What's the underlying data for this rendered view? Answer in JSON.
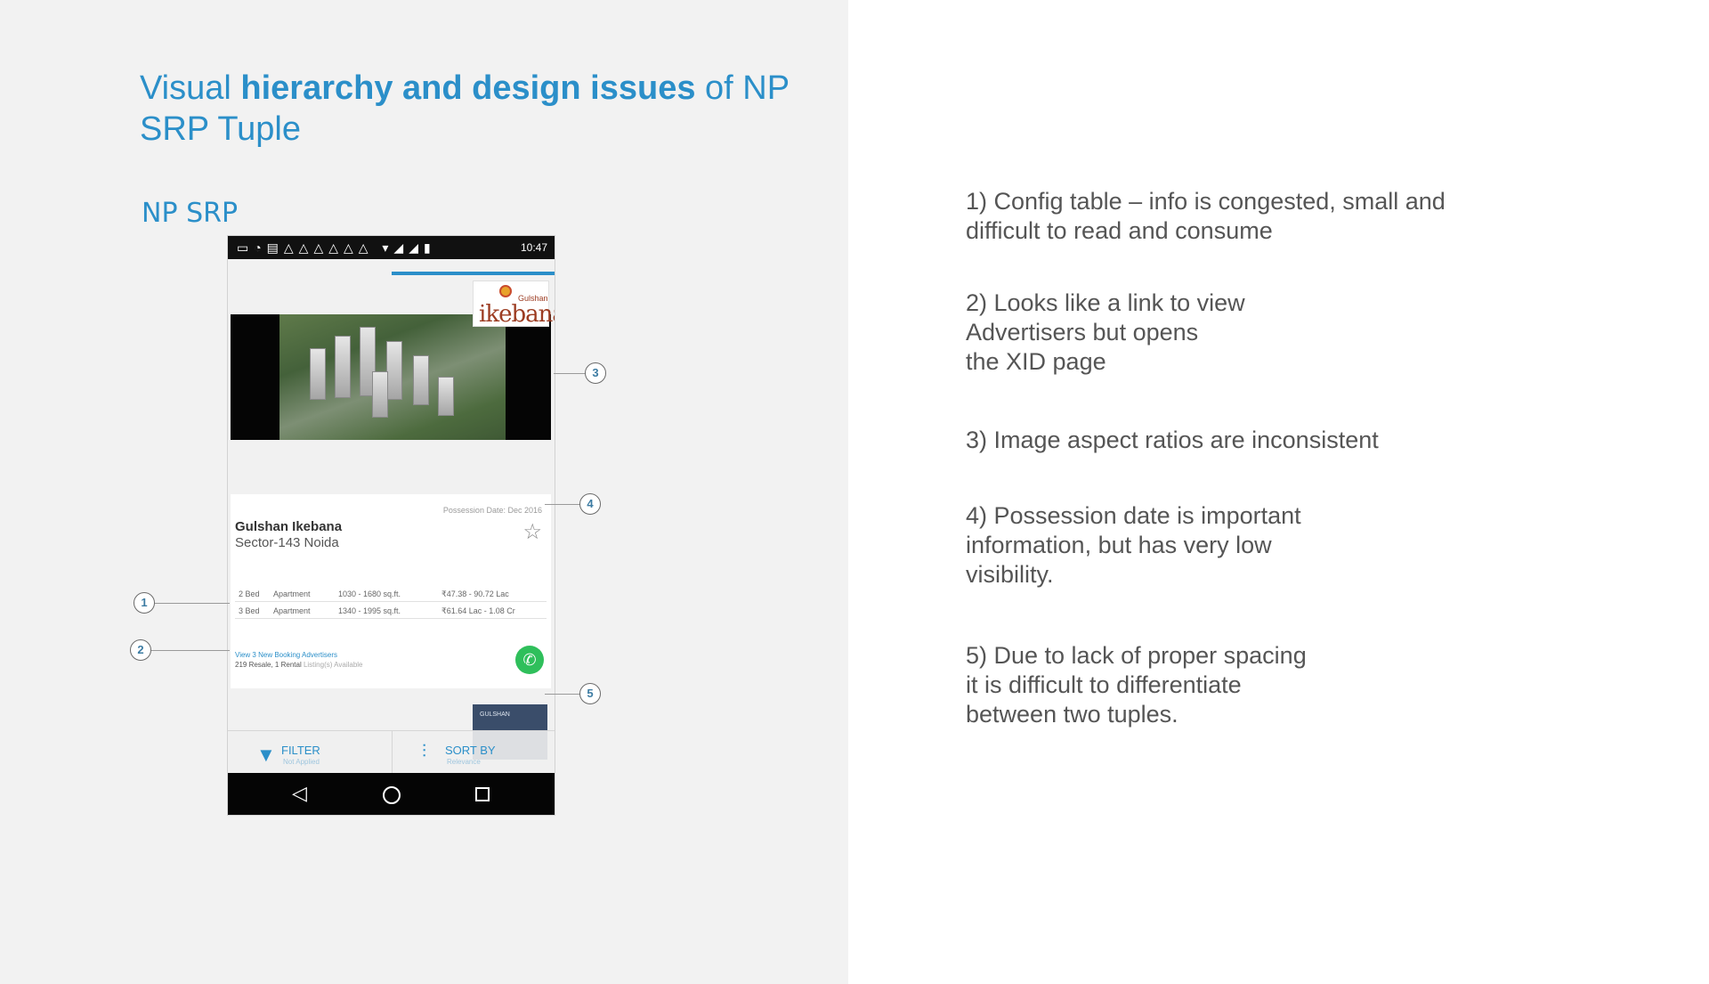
{
  "slide": {
    "title_lead": "Visual ",
    "title_bold": "hierarchy and design issues",
    "title_tail": " of NP SRP Tuple",
    "section_label": "NP SRP"
  },
  "phone": {
    "status_time": "10:47",
    "brand_small": "Gulshan",
    "brand_name": "ikebana",
    "possession_date": "Possession Date: Dec 2016",
    "project_name": "Gulshan Ikebana",
    "project_location": "Sector-143 Noida",
    "config_rows": [
      {
        "bed": "2 Bed",
        "type": "Apartment",
        "area": "1030 - 1680 sq.ft.",
        "price": "₹47.38 - 90.72 Lac"
      },
      {
        "bed": "3 Bed",
        "type": "Apartment",
        "area": "1340 - 1995 sq.ft.",
        "price": "₹61.64 Lac - 1.08 Cr"
      }
    ],
    "advertisers_link": "View 3 New Booking Advertisers",
    "resale_bold": "219 Resale, 1 Rental",
    "resale_light": " Listing(s) Available",
    "next_thumb_text": "GULSHAN",
    "filter_label": "FILTER",
    "filter_sub": "Not Applied",
    "sort_label": "SORT BY",
    "sort_sub": "Relevance"
  },
  "callouts": [
    "1",
    "2",
    "3",
    "4",
    "5"
  ],
  "notes": [
    "1) Config table – info is congested, small and\ndifficult to read and consume",
    "2) Looks like a link to view\nAdvertisers but opens\nthe XID page",
    "3) Image aspect ratios are inconsistent",
    "4) Possession date is important\ninformation, but has very low\nvisibility.",
    "5) Due to lack of proper spacing\nit is difficult to differentiate\nbetween two tuples."
  ],
  "colors": {
    "accent": "#2b8fc9",
    "call_green": "#2fbf5b",
    "left_panel_bg": "#f2f2f2",
    "note_text": "#555555"
  },
  "icons": [
    "star-icon",
    "phone-icon",
    "filter-icon",
    "sort-icon",
    "back-icon",
    "home-icon",
    "recent-apps-icon"
  ]
}
